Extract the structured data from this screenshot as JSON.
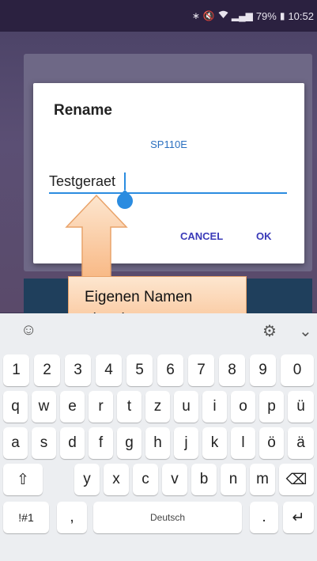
{
  "status_bar": {
    "icons": [
      "bluetooth-icon",
      "mute-icon",
      "wifi-icon",
      "signal-icon"
    ],
    "bluetooth": "∗",
    "mute": "🔇",
    "signal": "▂▄▆",
    "battery_text": "79%",
    "battery_icon": "▮",
    "time": "10:52"
  },
  "dialog": {
    "title": "Rename",
    "subtitle": "SP110E",
    "input_value": "Testgeraet",
    "cancel_label": "CANCEL",
    "ok_label": "OK"
  },
  "callout": {
    "line1": "Eigenen Namen",
    "line2": "eingeben"
  },
  "keyboard": {
    "toolbar": {
      "sticker": "☺",
      "settings": "⚙",
      "collapse": "⌄"
    },
    "row_numbers": [
      "1",
      "2",
      "3",
      "4",
      "5",
      "6",
      "7",
      "8",
      "9",
      "0"
    ],
    "row_q": [
      "q",
      "w",
      "e",
      "r",
      "t",
      "z",
      "u",
      "i",
      "o",
      "p",
      "ü"
    ],
    "row_a": [
      "a",
      "s",
      "d",
      "f",
      "g",
      "h",
      "j",
      "k",
      "l",
      "ö",
      "ä"
    ],
    "row_y": [
      "y",
      "x",
      "c",
      "v",
      "b",
      "n",
      "m"
    ],
    "shift": "⇧",
    "backspace": "⌫",
    "symbols": "!#1",
    "comma": ",",
    "space": "Deutsch",
    "period": ".",
    "enter": "↵"
  },
  "colors": {
    "accent": "#2b8ce0",
    "button_text": "#3a3ab8",
    "callout_fill": "#f8b884"
  }
}
